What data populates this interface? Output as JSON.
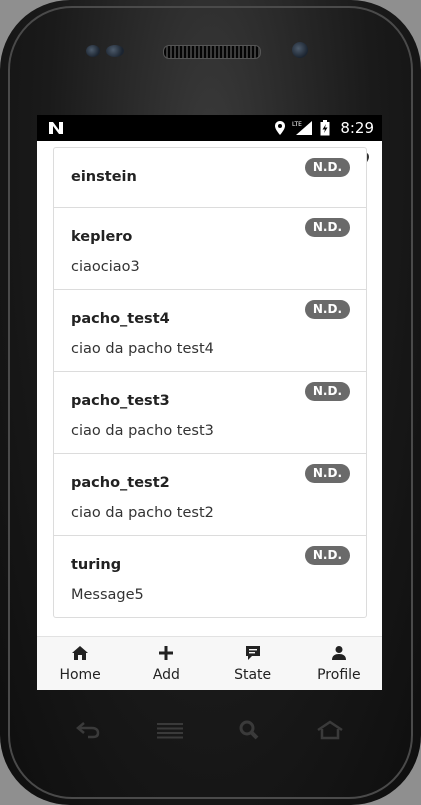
{
  "status_bar": {
    "time": "8:29",
    "notification_icon": "n-logo-icon",
    "icons": [
      "location-pin-icon",
      "lte-signal-icon",
      "battery-charging-icon"
    ]
  },
  "messages": [
    {
      "username": "einstein",
      "message": "",
      "badge": "N.D."
    },
    {
      "username": "keplero",
      "message": "ciaociao3",
      "badge": "N.D."
    },
    {
      "username": "pacho_test4",
      "message": "ciao da pacho test4",
      "badge": "N.D."
    },
    {
      "username": "pacho_test3",
      "message": "ciao da pacho test3",
      "badge": "N.D."
    },
    {
      "username": "pacho_test2",
      "message": "ciao da pacho test2",
      "badge": "N.D."
    },
    {
      "username": "turing",
      "message": "Message5",
      "badge": "N.D."
    }
  ],
  "nav": {
    "home": {
      "label": "Home",
      "icon": "home-icon"
    },
    "add": {
      "label": "Add",
      "icon": "plus-icon"
    },
    "state": {
      "label": "State",
      "icon": "chat-bubble-icon"
    },
    "profile": {
      "label": "Profile",
      "icon": "user-icon"
    }
  },
  "colors": {
    "badge_bg": "#6a6a6a",
    "status_bar_bg": "#000000",
    "nav_bg": "#f7f7f7"
  }
}
